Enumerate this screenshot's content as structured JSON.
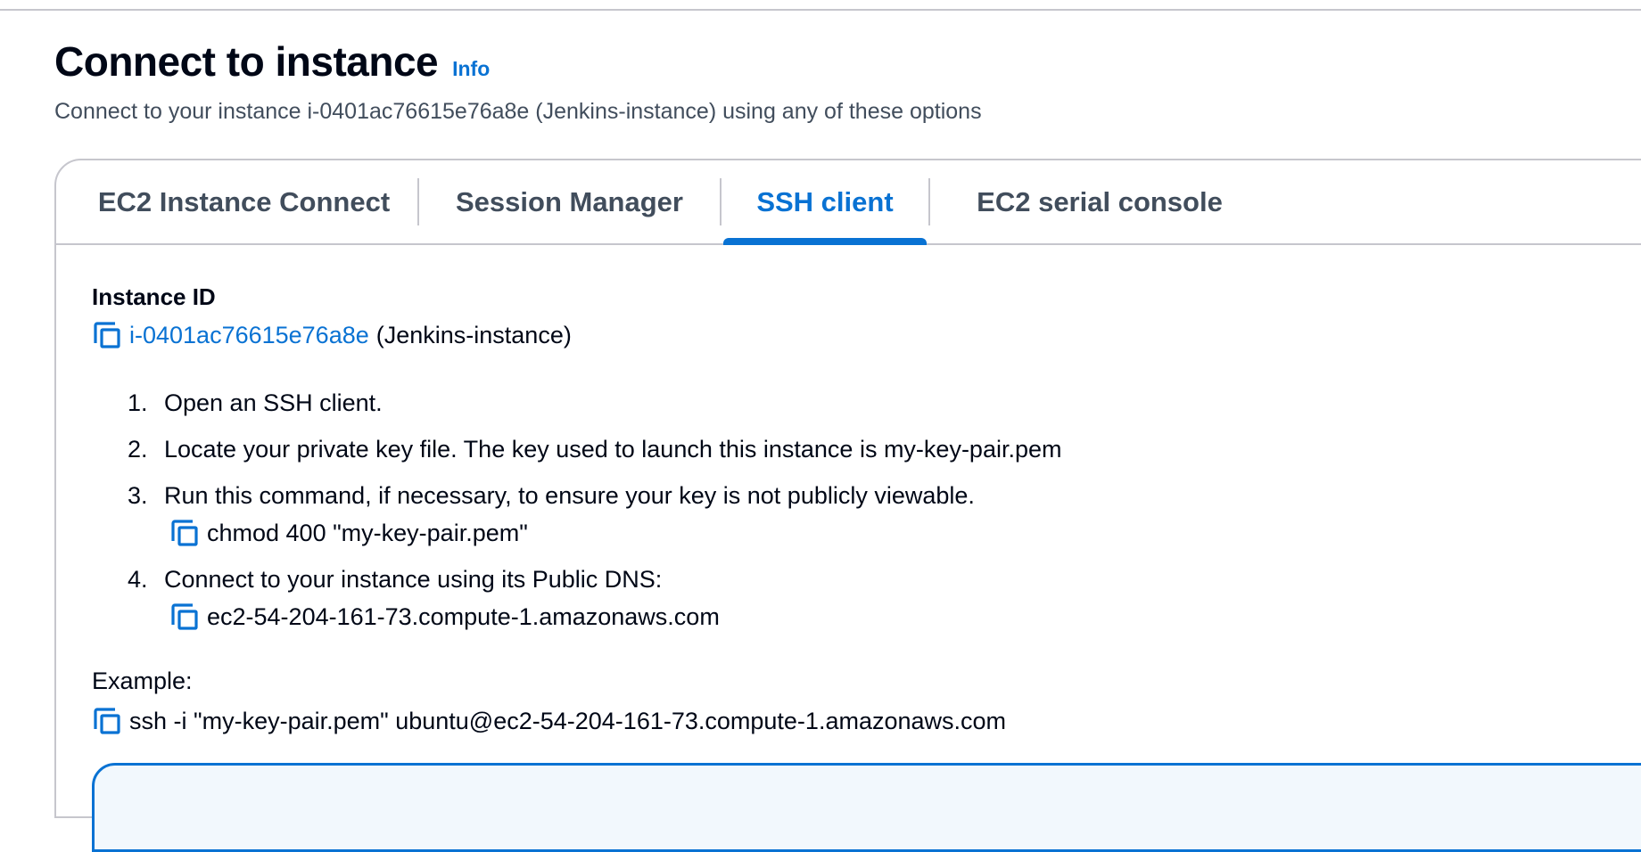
{
  "header": {
    "title": "Connect to instance",
    "info_label": "Info",
    "subtitle": "Connect to your instance i-0401ac76615e76a8e (Jenkins-instance) using any of these options"
  },
  "tabs": [
    {
      "label": "EC2 Instance Connect",
      "active": false
    },
    {
      "label": "Session Manager",
      "active": false
    },
    {
      "label": "SSH client",
      "active": true
    },
    {
      "label": "EC2 serial console",
      "active": false
    }
  ],
  "instance": {
    "heading": "Instance ID",
    "id": "i-0401ac76615e76a8e",
    "name": "(Jenkins-instance)"
  },
  "steps": [
    {
      "num": "1.",
      "text": "Open an SSH client."
    },
    {
      "num": "2.",
      "text": "Locate your private key file. The key used to launch this instance is my-key-pair.pem"
    },
    {
      "num": "3.",
      "text": "Run this command, if necessary, to ensure your key is not publicly viewable.",
      "command": "chmod 400 \"my-key-pair.pem\""
    },
    {
      "num": "4.",
      "text": "Connect to your instance using its Public DNS:",
      "command": "ec2-54-204-161-73.compute-1.amazonaws.com"
    }
  ],
  "example": {
    "label": "Example:",
    "command": "ssh -i \"my-key-pair.pem\" ubuntu@ec2-54-204-161-73.compute-1.amazonaws.com"
  },
  "colors": {
    "accent": "#0972d3",
    "text": "#000716",
    "muted": "#414d5c",
    "border": "#c6c6cd"
  },
  "icons": {
    "copy": "copy-icon"
  }
}
